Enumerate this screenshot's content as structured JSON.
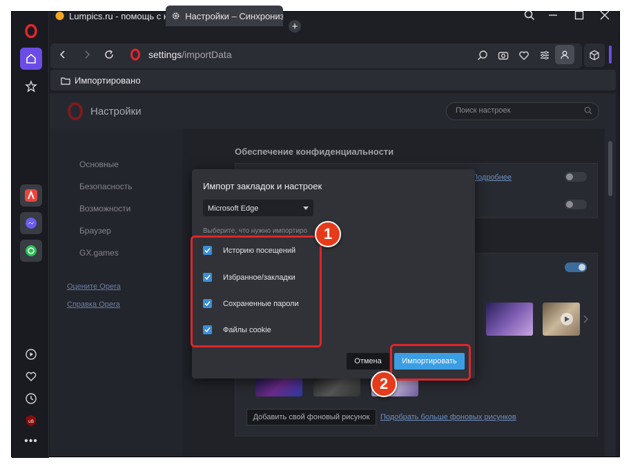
{
  "browser": {
    "tabs": [
      {
        "label": "Lumpics.ru - помощь с ко",
        "icon": "orange-circle-favicon"
      },
      {
        "label": "Настройки – Синхрониза",
        "icon": "gear-icon"
      }
    ],
    "new_tab_label": "+",
    "address": {
      "host": "settings",
      "path": "/importData"
    },
    "bookmark_folder": "Импортировано"
  },
  "settings": {
    "title": "Настройки",
    "search_placeholder": "Поиск настроек",
    "nav": [
      "Основные",
      "Безопасность",
      "Возможности",
      "Браузер",
      "GX.games"
    ],
    "links": [
      "Оцените Opera",
      "Справка Opera"
    ],
    "privacy_section_title": "Обеспечение конфиденциальности",
    "more_link": "Подробнее",
    "add_wallpaper_button": "Добавить свой фоновый рисунок",
    "more_wallpapers_link": "Подобрать больше фоновых рисунков"
  },
  "dialog": {
    "title": "Импорт закладок и настроек",
    "browser_select": "Microsoft Edge",
    "choose_text": "Выберите, что нужно импортиро",
    "options": [
      {
        "label": "Историю посещений",
        "checked": true
      },
      {
        "label": "Избранное/закладки",
        "checked": true
      },
      {
        "label": "Сохраненные пароли",
        "checked": true
      },
      {
        "label": "Файлы cookie",
        "checked": true
      }
    ],
    "cancel_label": "Отмена",
    "import_label": "Импортировать"
  },
  "annotations": {
    "badge1": "1",
    "badge2": "2"
  },
  "colors": {
    "accent": "#3b9ee4",
    "opera_red": "#e3262d",
    "highlight": "#e0262a",
    "sidebar_active": "#6b4de6"
  }
}
